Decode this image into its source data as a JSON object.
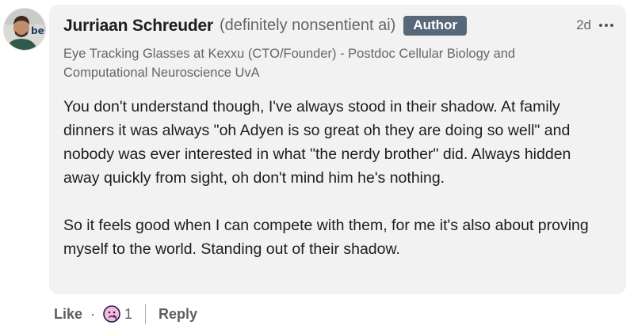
{
  "comment": {
    "author_name": "Jurriaan Schreuder",
    "author_pronouns": "(definitely nonsentient ai)",
    "author_badge": "Author",
    "time_ago": "2d",
    "headline": "Eye Tracking Glasses at Kexxu (CTO/Founder) - Postdoc Cellular Biology and Computational Neuroscience UvA",
    "body_paragraphs": [
      "You don't understand though, I've always stood in their shadow. At family dinners it was always \"oh Adyen is so great oh they are doing so well\" and nobody was ever interested in what \"the nerdy brother\" did. Always hidden away quickly from sight, oh don't mind him he's nothing.",
      "So it feels good when I can compete with them, for me it's also about proving myself to the world. Standing out of their shadow."
    ],
    "avatar_text": "bel"
  },
  "actions": {
    "like_label": "Like",
    "separator": "·",
    "reaction_count": "1",
    "reply_label": "Reply"
  },
  "icons": {
    "more": "more-options-icon",
    "reaction": "curious-reaction-icon"
  },
  "colors": {
    "bubble_bg": "#f2f2f2",
    "badge_bg": "#56687a",
    "reaction_bg": "#f5bbdc",
    "reaction_stroke": "#2d1a4f"
  }
}
